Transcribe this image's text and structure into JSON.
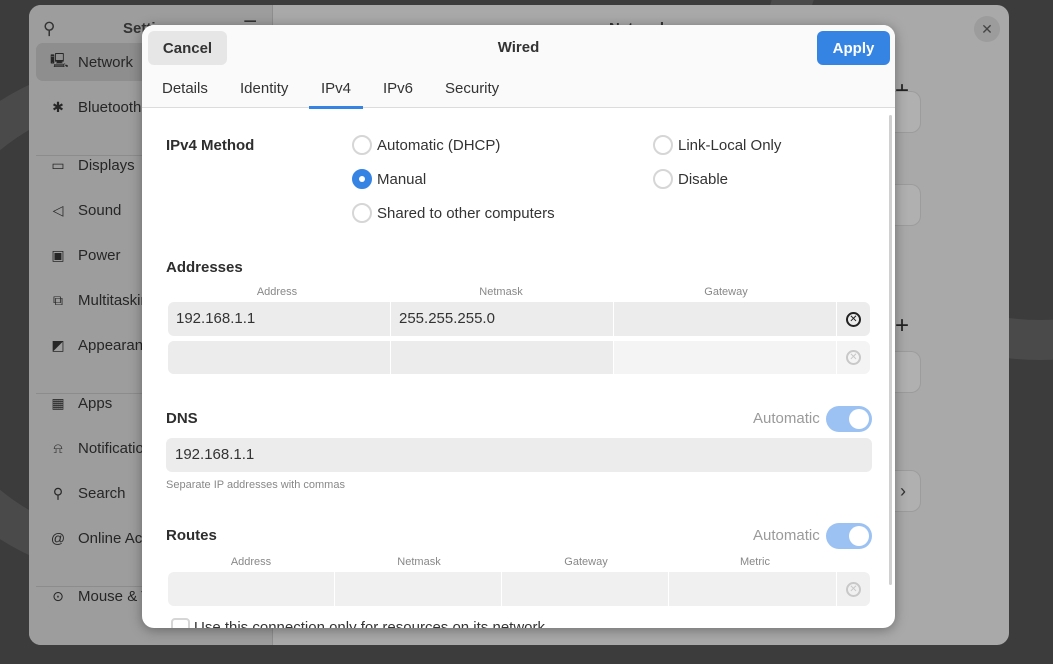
{
  "settings": {
    "title": "Settings",
    "sidebar": [
      {
        "label": "Network",
        "icon": "network-icon",
        "glyph": "🖳",
        "selected": true
      },
      {
        "label": "Bluetooth",
        "icon": "bluetooth-icon",
        "glyph": "✱"
      },
      {
        "label": "Displays",
        "icon": "display-icon",
        "glyph": "▭"
      },
      {
        "label": "Sound",
        "icon": "speaker-icon",
        "glyph": "◁"
      },
      {
        "label": "Power",
        "icon": "power-icon",
        "glyph": "▣"
      },
      {
        "label": "Multitasking",
        "icon": "multitasking-icon",
        "glyph": "⧉"
      },
      {
        "label": "Appearance",
        "icon": "appearance-icon",
        "glyph": "◩"
      },
      {
        "label": "Apps",
        "icon": "apps-icon",
        "glyph": "▦"
      },
      {
        "label": "Notifications",
        "icon": "bell-icon",
        "glyph": "⍾"
      },
      {
        "label": "Search",
        "icon": "search-icon",
        "glyph": "⚲"
      },
      {
        "label": "Online Accounts",
        "icon": "at-icon",
        "glyph": "@"
      },
      {
        "label": "Mouse & Touchpad",
        "icon": "mouse-icon",
        "glyph": "⊙"
      }
    ],
    "main_title": "Network"
  },
  "dialog": {
    "title": "Wired",
    "cancel": "Cancel",
    "apply": "Apply",
    "accent": "#3584e4",
    "tabs": [
      "Details",
      "Identity",
      "IPv4",
      "IPv6",
      "Security"
    ],
    "active_tab": "IPv4",
    "method": {
      "label": "IPv4 Method",
      "options": [
        "Automatic (DHCP)",
        "Manual",
        "Shared to other computers",
        "Link-Local Only",
        "Disable"
      ],
      "selected": "Manual"
    },
    "addresses": {
      "label": "Addresses",
      "columns": [
        "Address",
        "Netmask",
        "Gateway"
      ],
      "rows": [
        [
          "192.168.1.1",
          "255.255.255.0",
          ""
        ],
        [
          "",
          "",
          ""
        ]
      ]
    },
    "dns": {
      "label": "DNS",
      "automatic_label": "Automatic",
      "automatic": true,
      "value": "192.168.1.1",
      "hint": "Separate IP addresses with commas"
    },
    "routes": {
      "label": "Routes",
      "automatic_label": "Automatic",
      "automatic": true,
      "columns": [
        "Address",
        "Netmask",
        "Gateway",
        "Metric"
      ],
      "rows": [
        [
          "",
          "",
          "",
          ""
        ]
      ]
    },
    "only_local": {
      "label": "Use this connection only for resources on its network",
      "checked": false
    }
  }
}
